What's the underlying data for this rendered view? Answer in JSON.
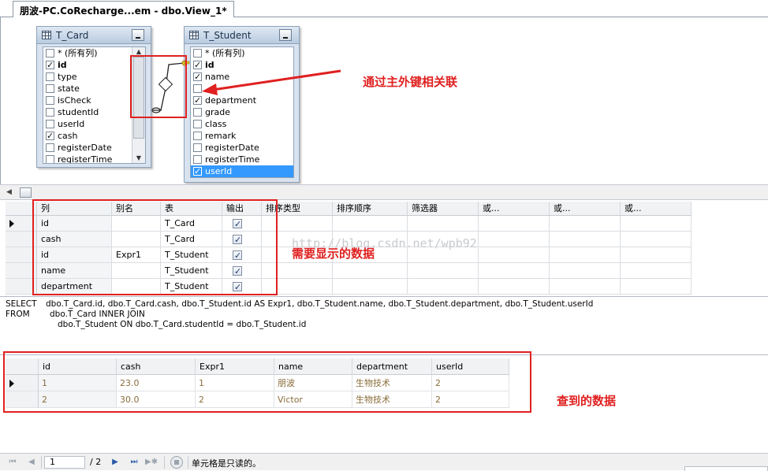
{
  "tab": {
    "title": "朋波-PC.CoRecharge...em - dbo.View_1*"
  },
  "diagram": {
    "tables": [
      {
        "name": "T_Card",
        "columns": [
          {
            "label": "* (所有列)",
            "checked": false,
            "bold": false
          },
          {
            "label": "id",
            "checked": true,
            "bold": true
          },
          {
            "label": "type",
            "checked": false,
            "bold": false
          },
          {
            "label": "state",
            "checked": false,
            "bold": false
          },
          {
            "label": "isCheck",
            "checked": false,
            "bold": false
          },
          {
            "label": "studentId",
            "checked": false,
            "bold": false
          },
          {
            "label": "userId",
            "checked": false,
            "bold": false
          },
          {
            "label": "cash",
            "checked": true,
            "bold": false
          },
          {
            "label": "registerDate",
            "checked": false,
            "bold": false
          },
          {
            "label": "registerTime",
            "checked": false,
            "bold": false
          }
        ]
      },
      {
        "name": "T_Student",
        "columns": [
          {
            "label": "* (所有列)",
            "checked": false,
            "bold": false
          },
          {
            "label": "id",
            "checked": true,
            "bold": true
          },
          {
            "label": "name",
            "checked": true,
            "bold": false
          },
          {
            "label": "",
            "checked": false,
            "bold": false
          },
          {
            "label": "department",
            "checked": true,
            "bold": false
          },
          {
            "label": "grade",
            "checked": false,
            "bold": false
          },
          {
            "label": "class",
            "checked": false,
            "bold": false
          },
          {
            "label": "remark",
            "checked": false,
            "bold": false
          },
          {
            "label": "registerDate",
            "checked": false,
            "bold": false
          },
          {
            "label": "registerTime",
            "checked": false,
            "bold": false
          },
          {
            "label": "userId",
            "checked": true,
            "bold": false,
            "selected": true
          }
        ]
      }
    ],
    "annotation_relation": "通过主外键相关联"
  },
  "criteria": {
    "headers": [
      "列",
      "别名",
      "表",
      "输出",
      "排序类型",
      "排序顺序",
      "筛选器",
      "或...",
      "或...",
      "或..."
    ],
    "rows": [
      {
        "column": "id",
        "alias": "",
        "table": "T_Card",
        "output": true
      },
      {
        "column": "cash",
        "alias": "",
        "table": "T_Card",
        "output": true
      },
      {
        "column": "id",
        "alias": "Expr1",
        "table": "T_Student",
        "output": true
      },
      {
        "column": "name",
        "alias": "",
        "table": "T_Student",
        "output": true
      },
      {
        "column": "department",
        "alias": "",
        "table": "T_Student",
        "output": true
      }
    ],
    "annotation": "需要显示的数据",
    "watermark": "http://blog.csdn.net/wpb92"
  },
  "sql": {
    "lines": [
      {
        "keyword": "SELECT",
        "text": "dbo.T_Card.id, dbo.T_Card.cash, dbo.T_Student.id AS Expr1, dbo.T_Student.name, dbo.T_Student.department, dbo.T_Student.userId"
      },
      {
        "keyword": "FROM",
        "text": "dbo.T_Card INNER JOIN"
      },
      {
        "keyword": "",
        "text": "dbo.T_Student ON dbo.T_Card.studentId = dbo.T_Student.id"
      }
    ]
  },
  "results": {
    "headers": [
      "id",
      "cash",
      "Expr1",
      "name",
      "department",
      "userId"
    ],
    "rows": [
      [
        "1",
        "23.0",
        "1",
        "朋波",
        "生物技术",
        "2"
      ],
      [
        "2",
        "30.0",
        "2",
        "Victor",
        "生物技术",
        "2"
      ]
    ],
    "annotation": "查到的数据"
  },
  "statusbar": {
    "page_value": "1",
    "page_total": "/ 2",
    "message": "单元格是只读的。"
  },
  "colors": {
    "annotation_red": "#e02020",
    "selection_blue": "#3399ff",
    "result_text": "#8a6d3b"
  }
}
